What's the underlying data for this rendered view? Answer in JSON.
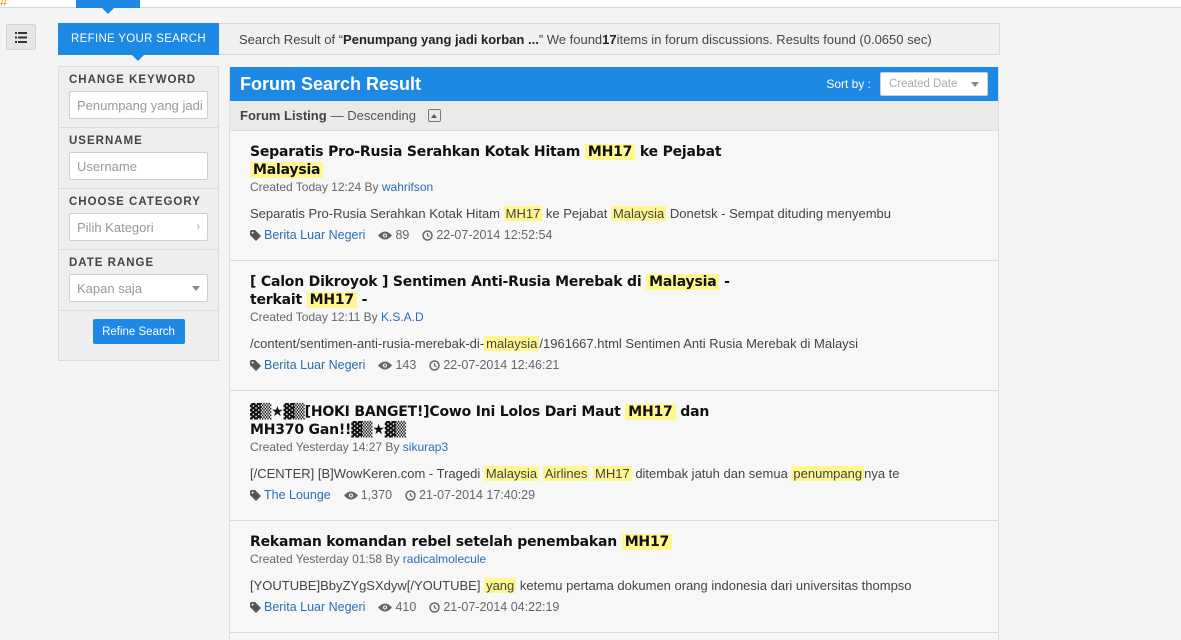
{
  "topbar": {
    "logo_glyph": "#"
  },
  "result_bar": {
    "prefix": "Search Result of “",
    "query": "Penumpang yang jadi korban ...",
    "mid": "” We found ",
    "count": "17",
    "suffix": " items in forum discussions. Results found (0.0650 sec)"
  },
  "sidebar": {
    "tab_label": "REFINE YOUR SEARCH",
    "keyword_label": "CHANGE KEYWORD",
    "keyword_value": "Penumpang yang jadi korban",
    "username_label": "USERNAME",
    "username_placeholder": "Username",
    "category_label": "CHOOSE CATEGORY",
    "category_value": "Pilih Kategori",
    "date_label": "DATE RANGE",
    "date_value": "Kapan saja",
    "refine_button": "Refine Search"
  },
  "main": {
    "title": "Forum Search Result",
    "sort_label": "Sort by :",
    "sort_value": "Created Date",
    "listing_label": "Forum Listing",
    "listing_order": " — Descending"
  },
  "results": [
    {
      "title_parts": [
        {
          "t": "Separatis Pro-Rusia Serahkan Kotak Hitam "
        },
        {
          "t": "MH17",
          "hl": true
        },
        {
          "t": " ke Pejabat "
        },
        {
          "br": true
        },
        {
          "t": "Malaysia",
          "hl": true
        }
      ],
      "created": "Created Today 12:24 By ",
      "author": "wahrifson",
      "snippet_parts": [
        {
          "t": "Separatis Pro-Rusia Serahkan Kotak Hitam "
        },
        {
          "t": "MH17",
          "hl": true
        },
        {
          "t": " ke Pejabat "
        },
        {
          "t": "Malaysia",
          "hl": true
        },
        {
          "t": " Donetsk - Sempat dituding menyembu"
        }
      ],
      "category": "Berita Luar Negeri",
      "views": "89",
      "date": "22-07-2014 12:52:54"
    },
    {
      "title_parts": [
        {
          "t": "[ Calon Dikroyok ] Sentimen Anti-Rusia Merebak di "
        },
        {
          "t": "Malaysia",
          "hl": true
        },
        {
          "t": " - "
        },
        {
          "br": true
        },
        {
          "t": "terkait "
        },
        {
          "t": "MH17",
          "hl": true
        },
        {
          "t": " -"
        }
      ],
      "created": "Created Today 12:11 By ",
      "author": "K.S.A.D",
      "snippet_parts": [
        {
          "t": "/content/sentimen-anti-rusia-merebak-di-"
        },
        {
          "t": "malaysia",
          "hl": true
        },
        {
          "t": "/1961667.html Sentimen Anti Rusia Merebak di Malaysi"
        }
      ],
      "category": "Berita Luar Negeri",
      "views": "143",
      "date": "22-07-2014 12:46:21"
    },
    {
      "title_parts": [
        {
          "t": "▓▒★▓▒[HOKI BANGET!]Cowo Ini Lolos Dari Maut "
        },
        {
          "t": "MH17",
          "hl": true
        },
        {
          "t": " dan "
        },
        {
          "br": true
        },
        {
          "t": "MH370 Gan!!▓▒★▓▒"
        }
      ],
      "created": "Created Yesterday 14:27 By ",
      "author": "sikurap3",
      "snippet_parts": [
        {
          "t": "[/CENTER] [B]WowKeren.com - Tragedi "
        },
        {
          "t": "Malaysia",
          "hl": true
        },
        {
          "t": " "
        },
        {
          "t": "Airlines",
          "hl": true
        },
        {
          "t": " "
        },
        {
          "t": "MH17",
          "hl": true
        },
        {
          "t": " ditembak jatuh dan semua "
        },
        {
          "t": "penumpang",
          "hl": true
        },
        {
          "t": "nya te"
        }
      ],
      "category": "The Lounge",
      "views": "1,370",
      "date": "21-07-2014 17:40:29"
    },
    {
      "title_parts": [
        {
          "t": "Rekaman komandan rebel setelah penembakan "
        },
        {
          "t": "MH17",
          "hl": true
        }
      ],
      "created": "Created Yesterday 01:58 By ",
      "author": "radicalmolecule",
      "snippet_parts": [
        {
          "t": "[YOUTUBE]BbyZYgSXdyw[/YOUTUBE] "
        },
        {
          "t": "yang",
          "hl": true
        },
        {
          "t": " ketemu pertama dokumen orang indonesia dari universitas thompso"
        }
      ],
      "category": "Berita Luar Negeri",
      "views": "410",
      "date": "21-07-2014 04:22:19"
    }
  ]
}
